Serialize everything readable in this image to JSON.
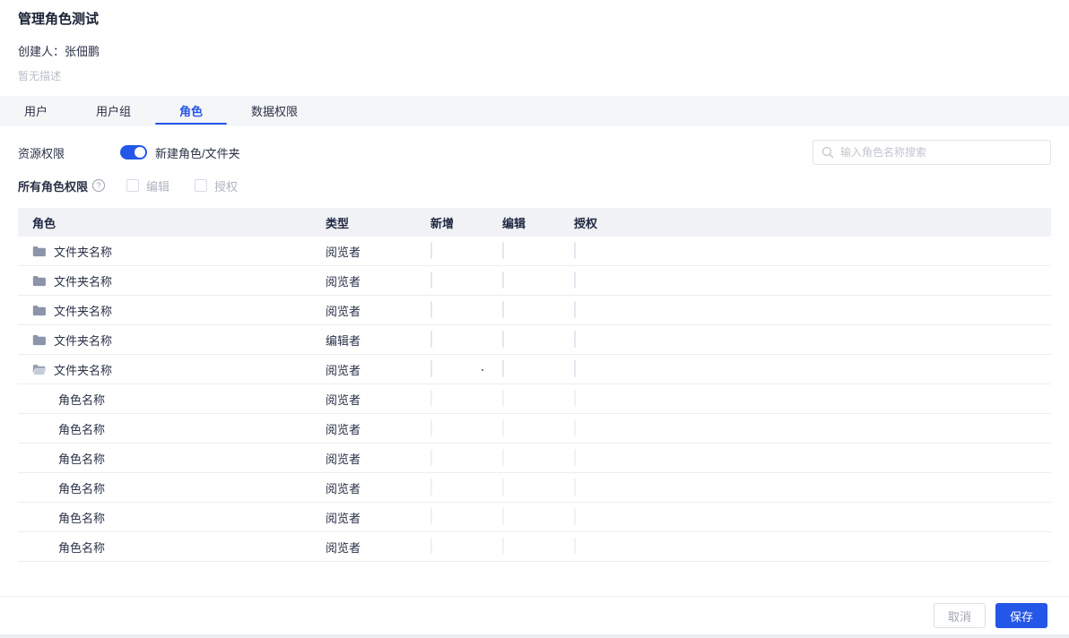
{
  "header": {
    "title": "管理角色测试",
    "creator": "创建人：张佃鹏",
    "description": "暂无描述"
  },
  "tabs": [
    {
      "label": "用户",
      "active": false
    },
    {
      "label": "用户组",
      "active": false
    },
    {
      "label": "角色",
      "active": true
    },
    {
      "label": "数据权限",
      "active": false
    }
  ],
  "controls": {
    "resource_permission_label": "资源权限",
    "toggle_state": "on",
    "new_role_label": "新建角色/文件夹",
    "search_placeholder": "输入角色名称搜索",
    "all_roles_label": "所有角色权限",
    "edit_checkbox_label": "编辑",
    "auth_checkbox_label": "授权",
    "edit_checkbox_checked": false,
    "auth_checkbox_checked": false
  },
  "table": {
    "columns": [
      "角色",
      "类型",
      "新增",
      "编辑",
      "授权"
    ],
    "rows": [
      {
        "icon": "folder-closed",
        "name": "文件夹名称",
        "type": "阅览者",
        "indent": false,
        "add": false,
        "edit": false,
        "auth": false
      },
      {
        "icon": "folder-closed",
        "name": "文件夹名称",
        "type": "阅览者",
        "indent": false,
        "add": false,
        "edit": false,
        "auth": false
      },
      {
        "icon": "folder-closed",
        "name": "文件夹名称",
        "type": "阅览者",
        "indent": false,
        "add": false,
        "edit": false,
        "auth": false
      },
      {
        "icon": "folder-closed",
        "name": "文件夹名称",
        "type": "编辑者",
        "indent": false,
        "add": false,
        "edit": false,
        "auth": false
      },
      {
        "icon": "folder-open",
        "name": "文件夹名称",
        "type": "阅览者",
        "indent": false,
        "add": false,
        "edit": false,
        "auth": false,
        "dot": true
      },
      {
        "icon": "none",
        "name": "角色名称",
        "type": "阅览者",
        "indent": true,
        "add": false,
        "edit": false,
        "auth": false
      },
      {
        "icon": "none",
        "name": "角色名称",
        "type": "阅览者",
        "indent": true,
        "add": false,
        "edit": false,
        "auth": false
      },
      {
        "icon": "none",
        "name": "角色名称",
        "type": "阅览者",
        "indent": true,
        "add": false,
        "edit": false,
        "auth": false
      },
      {
        "icon": "none",
        "name": "角色名称",
        "type": "阅览者",
        "indent": true,
        "add": false,
        "edit": false,
        "auth": false
      },
      {
        "icon": "none",
        "name": "角色名称",
        "type": "阅览者",
        "indent": true,
        "add": false,
        "edit": false,
        "auth": false
      },
      {
        "icon": "none",
        "name": "角色名称",
        "type": "阅览者",
        "indent": true,
        "add": false,
        "edit": false,
        "auth": false
      }
    ]
  },
  "footer": {
    "cancel_label": "取消",
    "save_label": "保存"
  },
  "colors": {
    "accent_blue": "#2456e8",
    "tabbar_bg": "#f5f6f8",
    "table_header_bg": "#f0f2f5",
    "muted_text": "#b9bec9"
  }
}
